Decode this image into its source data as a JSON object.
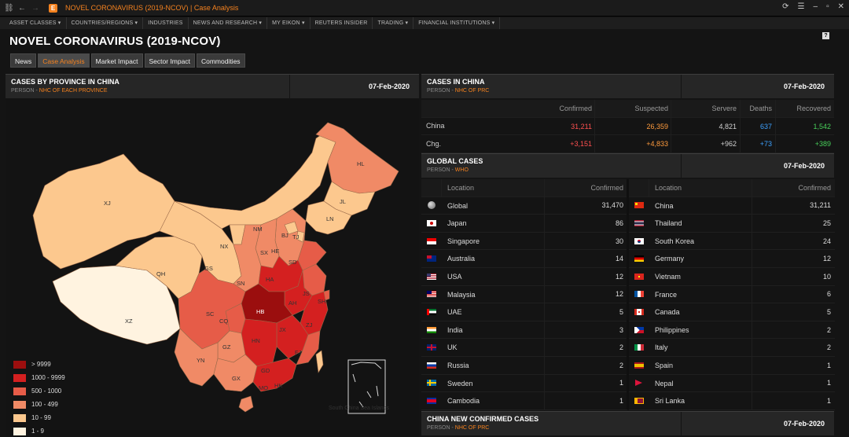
{
  "window": {
    "title": "NOVEL CORONAVIRUS (2019-NCOV) | Case Analysis"
  },
  "menu": [
    "ASSET CLASSES ▾",
    "COUNTRIES/REGIONS ▾",
    "INDUSTRIES",
    "NEWS AND RESEARCH ▾",
    "MY EIKON ▾",
    "REUTERS INSIDER",
    "TRADING ▾",
    "FINANCIAL INSTITUTIONS ▾"
  ],
  "page_title": "NOVEL CORONAVIRUS (2019-NCOV)",
  "help_label": "?",
  "tabs": [
    "News",
    "Case Analysis",
    "Market Impact",
    "Sector Impact",
    "Commodities"
  ],
  "colors": {
    "accent": "#f5821f",
    "red": "#ff5050",
    "orange": "#ff9b3d",
    "blue": "#3da1ff",
    "green": "#48d05a"
  },
  "map_panel": {
    "title": "CASES BY PROVINCE IN CHINA",
    "source_prefix": "PERSON - ",
    "source": "NHC OF EACH PROVINCE",
    "date": "07-Feb-2020"
  },
  "provinces": [
    "XJ",
    "XZ",
    "QH",
    "GS",
    "NM",
    "NX",
    "SN",
    "SX",
    "HE",
    "BJ",
    "TJ",
    "SD",
    "HA",
    "JS",
    "AH",
    "HB",
    "SH",
    "ZJ",
    "CQ",
    "SC",
    "GZ",
    "YN",
    "HN",
    "JX",
    "FJ",
    "GD",
    "GX",
    "HK",
    "MO",
    "HL",
    "JL",
    "LN"
  ],
  "south_china_sea": "South China Sea Islands",
  "legend": [
    {
      "label": "> 9999",
      "color": "#9b0e0e"
    },
    {
      "label": "1000 - 9999",
      "color": "#d42020"
    },
    {
      "label": "500 - 1000",
      "color": "#e65c48"
    },
    {
      "label": "100 - 499",
      "color": "#f08a66"
    },
    {
      "label": "10 - 99",
      "color": "#fcc88e"
    },
    {
      "label": "1 - 9",
      "color": "#fff3e0"
    }
  ],
  "china_panel": {
    "title": "CASES IN CHINA",
    "source_prefix": "PERSON - ",
    "source": "NHC OF PRC",
    "date": "07-Feb-2020"
  },
  "china_table": {
    "headers": [
      "",
      "Confirmed",
      "Suspected",
      "Servere",
      "Deaths",
      "Recovered"
    ],
    "rows": [
      [
        "China",
        "31,211",
        "26,359",
        "4,821",
        "637",
        "1,542"
      ],
      [
        "Chg.",
        "+3,151",
        "+4,833",
        "+962",
        "+73",
        "+389"
      ]
    ]
  },
  "global_panel": {
    "title": "GLOBAL CASES",
    "source_prefix": "PERSON - ",
    "source": "WHO",
    "date": "07-Feb-2020"
  },
  "global_headers": {
    "location": "Location",
    "confirmed": "Confirmed"
  },
  "global_left": [
    {
      "location": "Global",
      "confirmed": "31,470",
      "flag": "globe-icon"
    },
    {
      "location": "Japan",
      "confirmed": "86",
      "flag": "japan-flag-icon"
    },
    {
      "location": "Singapore",
      "confirmed": "30",
      "flag": "singapore-flag-icon"
    },
    {
      "location": "Australia",
      "confirmed": "14",
      "flag": "australia-flag-icon"
    },
    {
      "location": "USA",
      "confirmed": "12",
      "flag": "usa-flag-icon"
    },
    {
      "location": "Malaysia",
      "confirmed": "12",
      "flag": "malaysia-flag-icon"
    },
    {
      "location": "UAE",
      "confirmed": "5",
      "flag": "uae-flag-icon"
    },
    {
      "location": "India",
      "confirmed": "3",
      "flag": "india-flag-icon"
    },
    {
      "location": "UK",
      "confirmed": "2",
      "flag": "uk-flag-icon"
    },
    {
      "location": "Russia",
      "confirmed": "2",
      "flag": "russia-flag-icon"
    },
    {
      "location": "Sweden",
      "confirmed": "1",
      "flag": "sweden-flag-icon"
    },
    {
      "location": "Cambodia",
      "confirmed": "1",
      "flag": "cambodia-flag-icon"
    }
  ],
  "global_right": [
    {
      "location": "China",
      "confirmed": "31,211",
      "flag": "china-flag-icon"
    },
    {
      "location": "Thailand",
      "confirmed": "25",
      "flag": "thailand-flag-icon"
    },
    {
      "location": "South Korea",
      "confirmed": "24",
      "flag": "south-korea-flag-icon"
    },
    {
      "location": "Germany",
      "confirmed": "12",
      "flag": "germany-flag-icon"
    },
    {
      "location": "Vietnam",
      "confirmed": "10",
      "flag": "vietnam-flag-icon"
    },
    {
      "location": "France",
      "confirmed": "6",
      "flag": "france-flag-icon"
    },
    {
      "location": "Canada",
      "confirmed": "5",
      "flag": "canada-flag-icon"
    },
    {
      "location": "Philippines",
      "confirmed": "2",
      "flag": "philippines-flag-icon"
    },
    {
      "location": "Italy",
      "confirmed": "2",
      "flag": "italy-flag-icon"
    },
    {
      "location": "Spain",
      "confirmed": "1",
      "flag": "spain-flag-icon"
    },
    {
      "location": "Nepal",
      "confirmed": "1",
      "flag": "nepal-flag-icon"
    },
    {
      "location": "Sri Lanka",
      "confirmed": "1",
      "flag": "sri-lanka-flag-icon"
    }
  ],
  "new_panel": {
    "title": "CHINA NEW CONFIRMED CASES",
    "source_prefix": "PERSON - ",
    "source": "NHC OF PRC",
    "date": "07-Feb-2020"
  }
}
